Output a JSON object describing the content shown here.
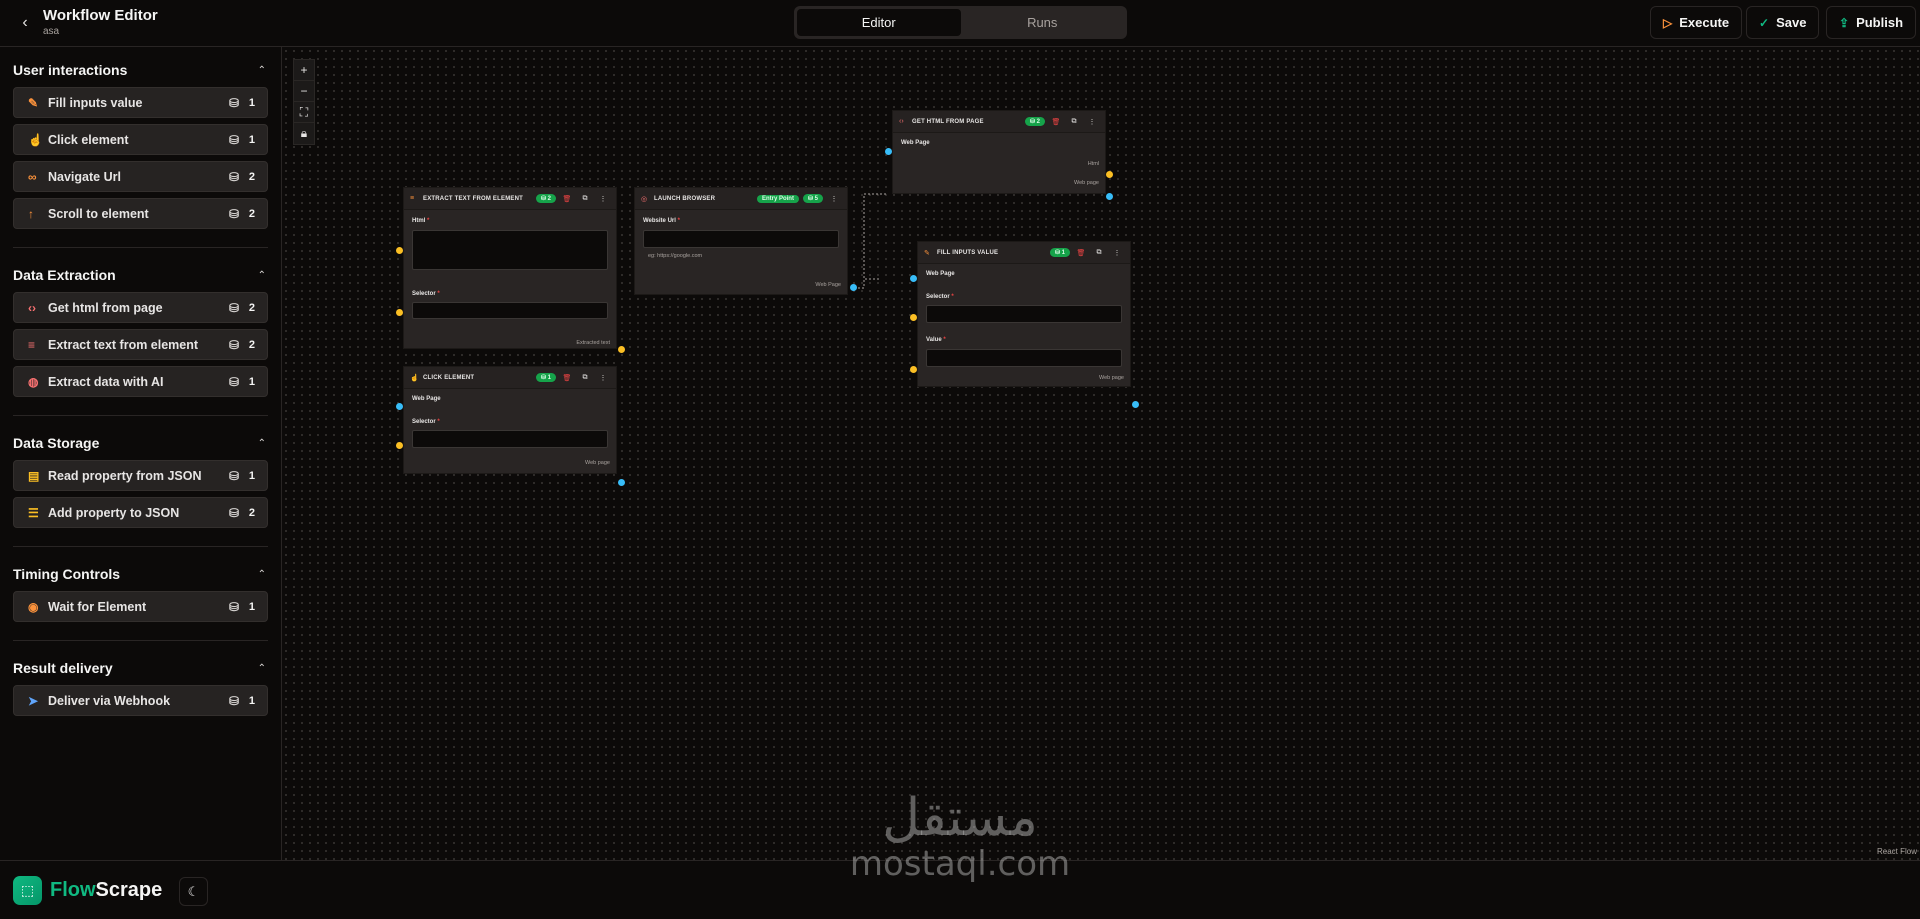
{
  "header": {
    "title": "Workflow Editor",
    "subtitle": "asa",
    "tabs": [
      {
        "label": "Editor"
      },
      {
        "label": "Runs"
      }
    ],
    "execute_label": "Execute",
    "save_label": "Save",
    "publish_label": "Publish"
  },
  "sidebar": {
    "sections": [
      {
        "title": "User interactions",
        "items": [
          {
            "label": "Fill inputs value",
            "count": "1"
          },
          {
            "label": "Click element",
            "count": "1"
          },
          {
            "label": "Navigate Url",
            "count": "2"
          },
          {
            "label": "Scroll to element",
            "count": "2"
          }
        ]
      },
      {
        "title": "Data Extraction",
        "items": [
          {
            "label": "Get html from page",
            "count": "2"
          },
          {
            "label": "Extract text from element",
            "count": "2"
          },
          {
            "label": "Extract data with AI",
            "count": "1"
          }
        ]
      },
      {
        "title": "Data Storage",
        "items": [
          {
            "label": "Read property from JSON",
            "count": "1"
          },
          {
            "label": "Add property to JSON",
            "count": "2"
          }
        ]
      },
      {
        "title": "Timing Controls",
        "items": [
          {
            "label": "Wait for Element",
            "count": "1"
          }
        ]
      },
      {
        "title": "Result delivery",
        "items": [
          {
            "label": "Deliver via Webhook",
            "count": "1"
          }
        ]
      }
    ]
  },
  "footer": {
    "logo_part1": "Flow",
    "logo_part2": "Scrape"
  },
  "canvas": {
    "attribution": "React Flow",
    "nodes": {
      "extract_text": {
        "title": "EXTRACT TEXT FROM ELEMENT",
        "credits": "2",
        "html_label": "Html",
        "selector_label": "Selector",
        "output_label": "Extracted text"
      },
      "launch_browser": {
        "title": "LAUNCH BROWSER",
        "entry_badge": "Entry Point",
        "credits": "5",
        "url_label": "Website Url",
        "url_help": "eg: https://google.com",
        "output_label": "Web Page"
      },
      "get_html": {
        "title": "GET HTML FROM PAGE",
        "credits": "2",
        "input_label": "Web Page",
        "output_html": "Html",
        "output_page": "Web page"
      },
      "fill_inputs": {
        "title": "FILL INPUTS VALUE",
        "credits": "1",
        "input_label": "Web Page",
        "selector_label": "Selector",
        "value_label": "Value",
        "output_label": "Web page"
      },
      "click_element": {
        "title": "CLICK ELEMENT",
        "credits": "1",
        "input_label": "Web Page",
        "selector_label": "Selector",
        "output_label": "Web page"
      }
    }
  },
  "watermark": {
    "arabic": "مستقل",
    "latin": "mostaql.com"
  },
  "colors": {
    "accent": "#10b981",
    "node_icon": "#fb923c",
    "handle_string": "#fbbf24",
    "handle_page": "#38bdf8",
    "badge": "#16a34a"
  }
}
